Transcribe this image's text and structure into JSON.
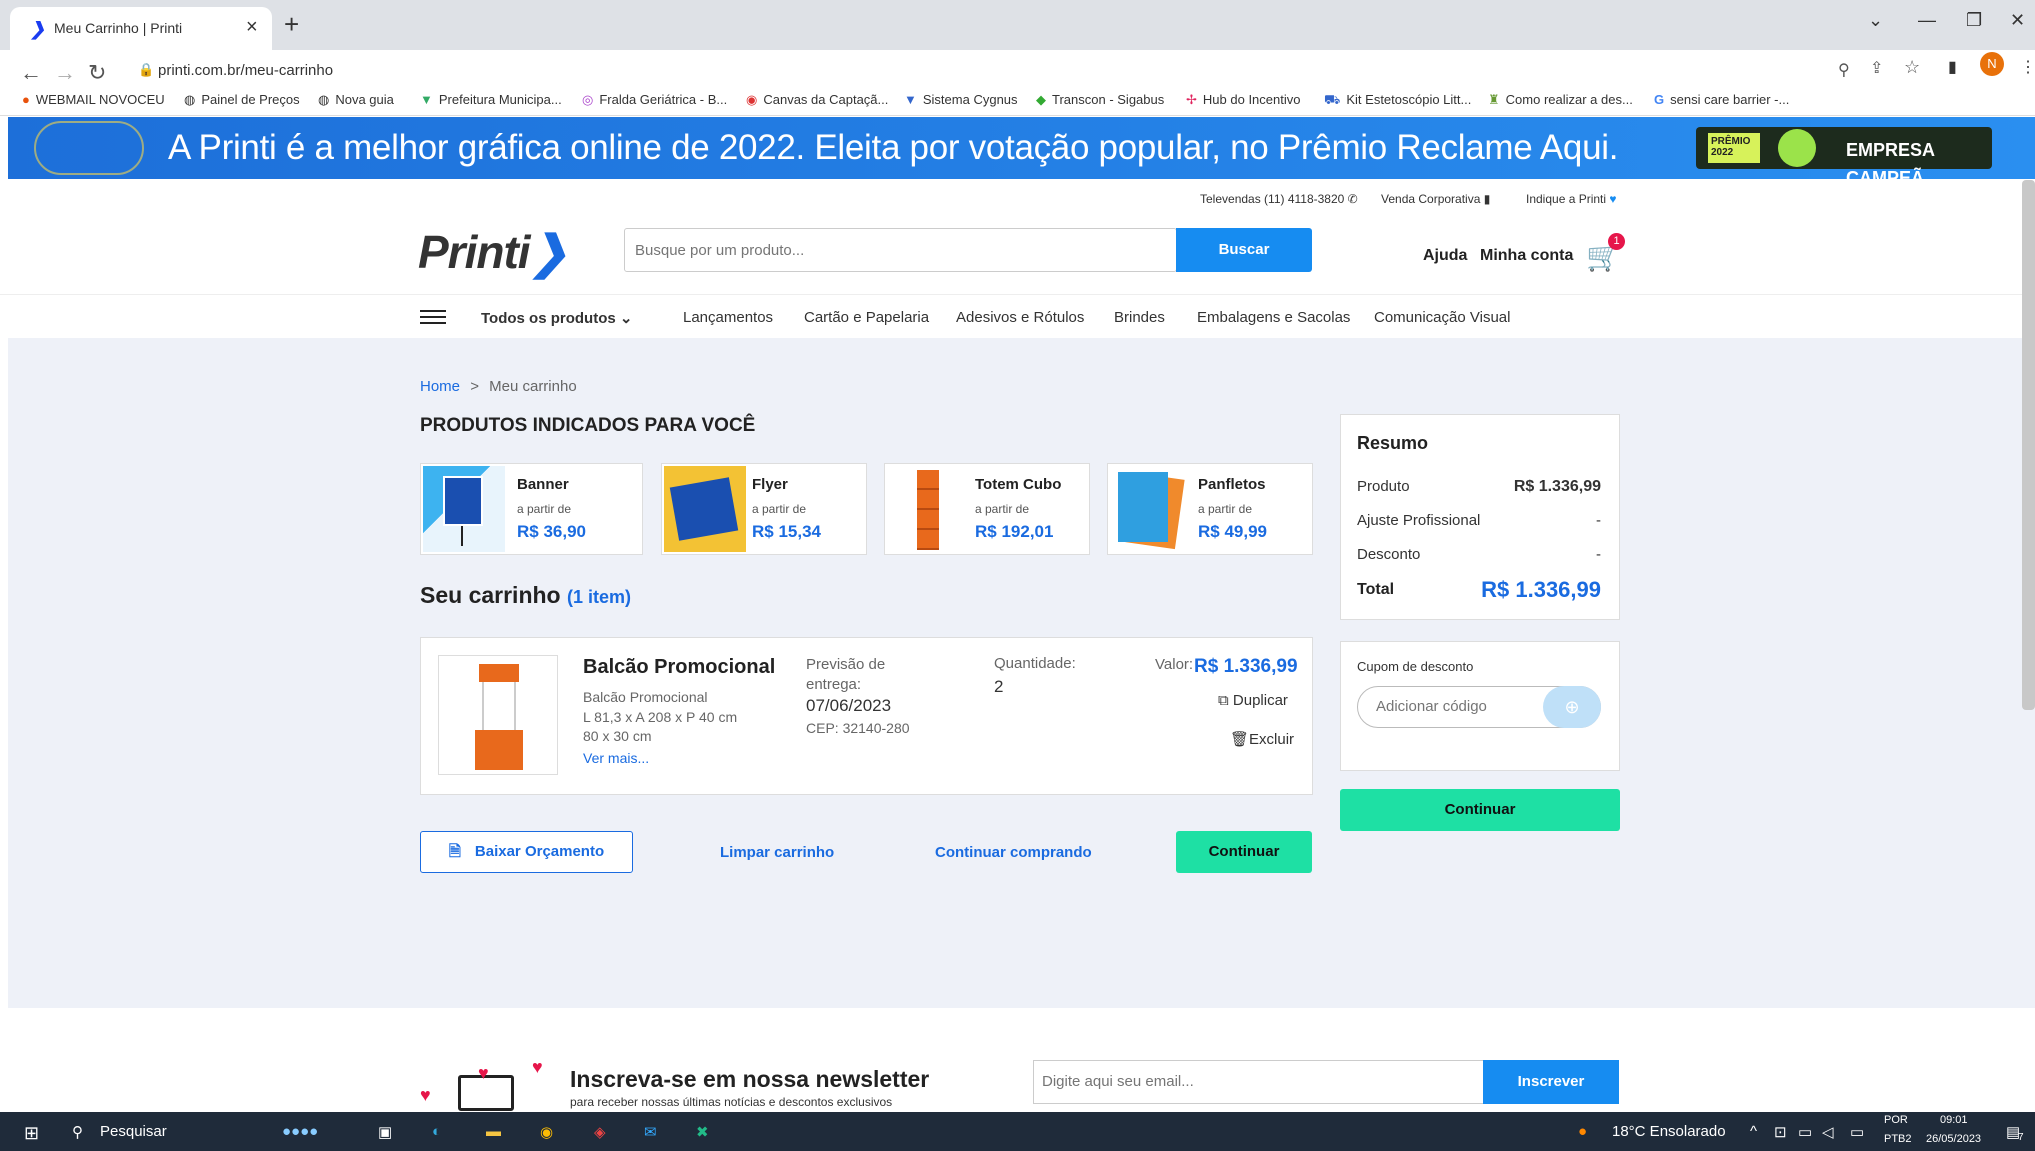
{
  "browser": {
    "tab_title": "Meu Carrinho | Printi",
    "url": "printi.com.br/meu-carrinho",
    "bookmarks": [
      "WEBMAIL NOVOCEU",
      "Painel de Preços",
      "Nova guia",
      "Prefeitura Municipa...",
      "Fralda Geriátrica - B...",
      "Canvas da Captaçã...",
      "Sistema Cygnus",
      "Transcon - Sigabus",
      "Hub do Incentivo",
      "Kit Estetoscópio Litt...",
      "Como realizar a des...",
      "sensi care barrier -..."
    ],
    "profile_initial": "N"
  },
  "promo": {
    "text": "A Printi é a melhor gráfica online de 2022. Eleita por votação popular, no Prêmio Reclame Aqui.",
    "badge_premio": "PRÊMIO 2022",
    "badge_label": "EMPRESA CAMPEÃ"
  },
  "utility": {
    "televendas": "Televendas (11) 4118-3820",
    "corporativa": "Venda Corporativa",
    "indique": "Indique a Printi"
  },
  "header": {
    "logo": "Printi",
    "search_placeholder": "Busque por um produto...",
    "search_button": "Buscar",
    "help": "Ajuda",
    "account": "Minha conta",
    "cart_count": "1"
  },
  "nav": {
    "all_products": "Todos os produtos",
    "items": [
      "Lançamentos",
      "Cartão e Papelaria",
      "Adesivos e Rótulos",
      "Brindes",
      "Embalagens e Sacolas",
      "Comunicação Visual"
    ]
  },
  "breadcrumb": {
    "home": "Home",
    "sep": ">",
    "current": "Meu carrinho"
  },
  "recommended": {
    "title": "PRODUTOS INDICADOS PARA VOCÊ",
    "from_label": "a partir de",
    "products": [
      {
        "name": "Banner",
        "price": "R$ 36,90"
      },
      {
        "name": "Flyer",
        "price": "R$ 15,34"
      },
      {
        "name": "Totem Cubo",
        "price": "R$ 192,01"
      },
      {
        "name": "Panfletos",
        "price": "R$ 49,99"
      }
    ]
  },
  "cart": {
    "title": "Seu carrinho",
    "count": "(1 item)",
    "item": {
      "name": "Balcão Promocional",
      "desc1": "Balcão Promocional",
      "desc2": "L 81,3 x A 208 x P 40 cm",
      "desc3": "80 x 30 cm",
      "more": "Ver mais...",
      "delivery_label": "Previsão de entrega:",
      "delivery_date": "07/06/2023",
      "cep": "CEP: 32140-280",
      "qty_label": "Quantidade:",
      "qty": "2",
      "value_label": "Valor:",
      "value": "R$ 1.336,99",
      "duplicate": "Duplicar",
      "delete": "Excluir"
    },
    "btn_budget": "Baixar Orçamento",
    "btn_clear": "Limpar carrinho",
    "btn_keep": "Continuar comprando",
    "btn_continue": "Continuar"
  },
  "summary": {
    "title": "Resumo",
    "product_label": "Produto",
    "product_value": "R$ 1.336,99",
    "adjust_label": "Ajuste Profissional",
    "adjust_value": "-",
    "discount_label": "Desconto",
    "discount_value": "-",
    "total_label": "Total",
    "total_value": "R$ 1.336,99",
    "coupon_label": "Cupom de desconto",
    "coupon_placeholder": "Adicionar código",
    "continue": "Continuar"
  },
  "newsletter": {
    "title": "Inscreva-se em nossa newsletter",
    "subtitle": "para receber nossas últimas notícias e descontos exclusivos",
    "placeholder": "Digite aqui seu email...",
    "button": "Inscrever"
  },
  "taskbar": {
    "search": "Pesquisar",
    "weather": "18°C Ensolarado",
    "lang1": "POR",
    "lang2": "PTB2",
    "time": "09:01",
    "date": "26/05/2023",
    "notif": "7"
  },
  "colors": {
    "accent": "#1a6be0",
    "button_blue": "#168cf1",
    "green": "#1ee0a4",
    "bg": "#eef1f8"
  }
}
